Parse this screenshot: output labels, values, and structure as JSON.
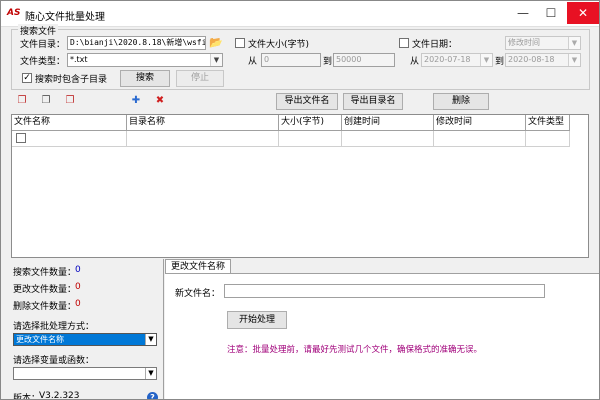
{
  "window": {
    "logo": "AS",
    "title": "随心文件批量处理",
    "minimize": "—",
    "maximize": "☐",
    "close": "✕"
  },
  "search": {
    "group_title": "搜索文件",
    "dir_label": "文件目录：",
    "dir_value": "D:\\bianji\\2020.8.18\\新增\\wsfil",
    "type_label": "文件类型：",
    "type_value": "*.txt",
    "subdir_label": "搜索时包含子目录",
    "subdir_checked": "✓",
    "search_button": "搜索",
    "stop_button": "停止",
    "size_label": "文件大小(字节)",
    "size_from_label": "从",
    "size_from": "0",
    "size_to_label": "到",
    "size_to": "50000",
    "date_label": "文件日期：",
    "date_mode": "修改时间",
    "date_from_label": "从",
    "date_from": "2020-07-18",
    "date_to_label": "到",
    "date_to": "2020-08-18"
  },
  "toolbar": {
    "export_files": "导出文件名",
    "export_dirs": "导出目录名",
    "delete": "删除"
  },
  "grid": {
    "columns": [
      "文件名称",
      "目录名称",
      "大小(字节)",
      "创建时间",
      "修改时间",
      "文件类型"
    ]
  },
  "stats": {
    "search_count_label": "搜索文件数量：",
    "search_count": "0",
    "changed_count_label": "更改文件数量：",
    "changed_count": "0",
    "deleted_count_label": "删除文件数量：",
    "deleted_count": "0",
    "batch_mode_label": "请选择批处理方式：",
    "batch_mode_value": "更改文件名称",
    "var_label": "请选择变量或函数：",
    "var_value": "",
    "version_label": "版本：",
    "version": "V3.2.323"
  },
  "tab": {
    "name": "更改文件名称",
    "new_name_label": "新文件名：",
    "new_name_value": "",
    "start_button": "开始处理",
    "note": "注意：批量处理前，请最好先测试几个文件，确保格式的准确无误。"
  },
  "colors": {
    "selected": "#0078d7",
    "count_blue": "#0000c0",
    "count_red": "#c00000",
    "note": "#a0007a"
  }
}
